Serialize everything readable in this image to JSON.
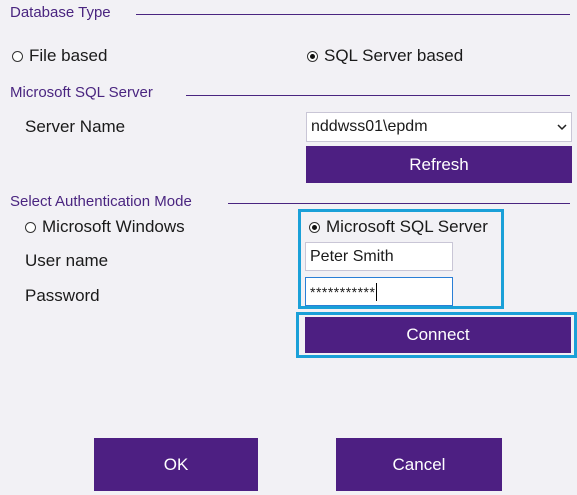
{
  "database_type": {
    "title": "Database Type",
    "file_based_label": "File based",
    "sql_server_based_label": "SQL Server based",
    "selected": "sql_server_based"
  },
  "sql_server": {
    "title": "Microsoft SQL Server",
    "server_name_label": "Server Name",
    "server_name_value": "nddwss01\\epdm",
    "refresh_label": "Refresh"
  },
  "auth": {
    "title": "Select Authentication Mode",
    "windows_label": "Microsoft Windows",
    "sql_server_label": "Microsoft SQL Server",
    "selected": "sql_server",
    "username_label": "User name",
    "username_value": "Peter Smith",
    "password_label": "Password",
    "password_value": "***********",
    "connect_label": "Connect"
  },
  "footer": {
    "ok_label": "OK",
    "cancel_label": "Cancel"
  },
  "colors": {
    "accent": "#4d1f82",
    "highlight": "#1aa0d8",
    "background": "#f2f1f5"
  }
}
